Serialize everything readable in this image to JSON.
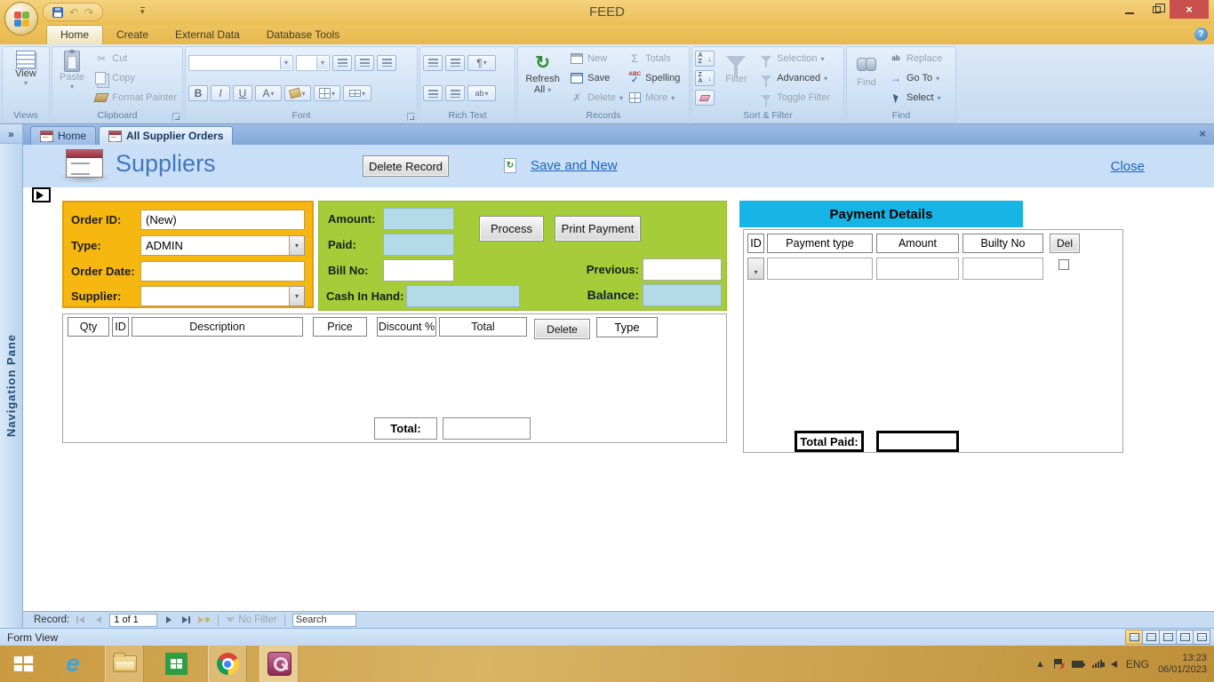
{
  "window": {
    "title": "FEED"
  },
  "icons": {
    "chevrons": "»",
    "dropdown": "▾",
    "undo": "↶",
    "redo": "↷",
    "refresh": "↻",
    "sigma": "Σ",
    "check": "✓",
    "x_mark": "✗",
    "scissors": "✂",
    "arrow_right": "→",
    "close_x": "×",
    "pilcrow": "¶",
    "help": "?",
    "abc": "ABC",
    "sort_a": "A",
    "sort_z": "Z",
    "arrow_down": "↓",
    "up_triangle": "▲",
    "ie_e": "e",
    "highlight_ab": "ab",
    "replace_ab": "ab"
  },
  "ribbon_tabs": [
    "Home",
    "Create",
    "External Data",
    "Database Tools"
  ],
  "ribbon": {
    "views": {
      "group": "Views",
      "view": "View"
    },
    "clipboard": {
      "group": "Clipboard",
      "paste": "Paste",
      "cut": "Cut",
      "copy": "Copy",
      "format_painter": "Format Painter"
    },
    "font": {
      "group": "Font",
      "bold": "B",
      "italic": "I",
      "underline": "U",
      "color": "A"
    },
    "rich_text": {
      "group": "Rich Text"
    },
    "records": {
      "group": "Records",
      "refresh_all": "Refresh All",
      "new": "New",
      "save": "Save",
      "delete": "Delete",
      "totals": "Totals",
      "spelling": "Spelling",
      "more": "More"
    },
    "sort_filter": {
      "group": "Sort & Filter",
      "filter": "Filter",
      "selection": "Selection",
      "advanced": "Advanced",
      "toggle_filter": "Toggle Filter"
    },
    "find": {
      "group": "Find",
      "find": "Find",
      "replace": "Replace",
      "goto": "Go To",
      "select": "Select"
    }
  },
  "doc_tabs": [
    "Home",
    "All Supplier Orders"
  ],
  "nav_pane_label": "Navigation Pane",
  "form": {
    "title": "Suppliers",
    "delete_record": "Delete Record",
    "save_and_new": "Save and New",
    "close": "Close"
  },
  "order_panel": {
    "order_id_label": "Order ID:",
    "order_id_value": "(New)",
    "type_label": "Type:",
    "type_value": "ADMIN",
    "order_date_label": "Order Date:",
    "order_date_value": "",
    "supplier_label": "Supplier:",
    "supplier_value": ""
  },
  "payment_panel": {
    "amount_label": "Amount:",
    "paid_label": "Paid:",
    "bill_no_label": "Bill No:",
    "cash_label": "Cash In Hand:",
    "process": "Process",
    "print_payment": "Print Payment",
    "previous_label": "Previous:",
    "balance_label": "Balance:"
  },
  "items_table": {
    "columns": [
      "Qty",
      "ID",
      "Description",
      "Price",
      "Discount %",
      "Total"
    ],
    "delete_button": "Delete",
    "type_button": "Type",
    "total_label": "Total:"
  },
  "payment_details": {
    "title": "Payment Details",
    "columns": [
      "ID",
      "Payment type",
      "Amount",
      "Builty No"
    ],
    "del_button": "Del",
    "total_paid_label": "Total Paid:"
  },
  "record_nav": {
    "label": "Record:",
    "position": "1 of 1",
    "no_filter": "No Filter",
    "search": "Search"
  },
  "status_bar": {
    "text": "Form View"
  },
  "taskbar": {
    "language": "ENG",
    "time": "13:23",
    "date": "06/01/2023"
  },
  "colors": {
    "titlebar": "#EEC35D",
    "ribbon": "#D5E5F6",
    "orange_panel": "#F6B711",
    "orange_border": "#E39B0E",
    "green_panel": "#A6CC39",
    "cyan_header": "#17B5E5",
    "field_blue": "#B3DAE8",
    "taskbar": "#C49540",
    "link": "#1965C0",
    "close_red": "#C9504C",
    "title_blue": "#4377BE"
  }
}
